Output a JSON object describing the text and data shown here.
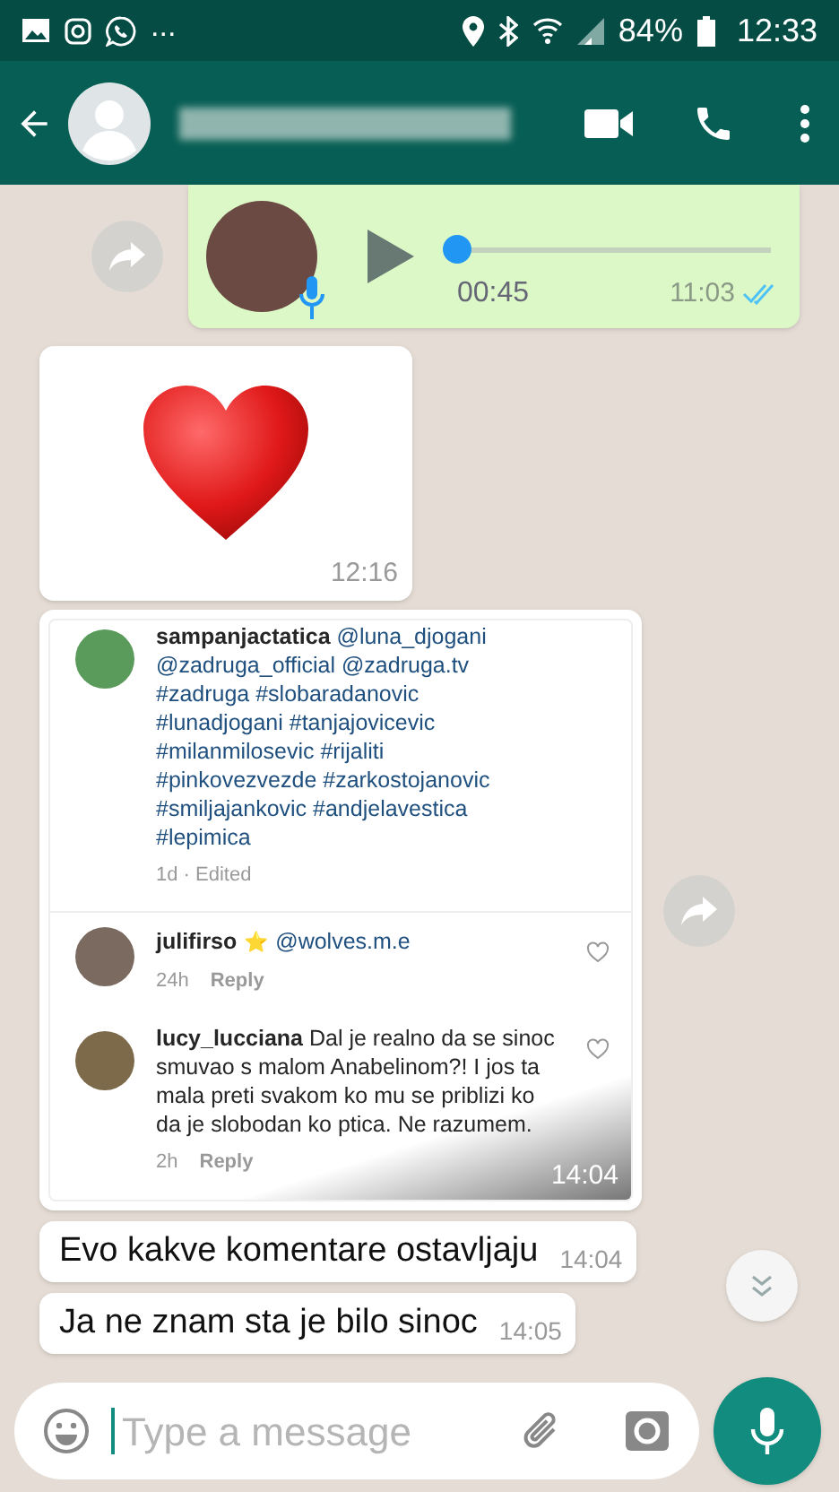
{
  "status_bar": {
    "more": "...",
    "battery": "84%",
    "time": "12:33"
  },
  "messages": [
    {
      "kind": "voice",
      "duration": "00:45",
      "time": "11:03",
      "level": 0,
      "read": true
    },
    {
      "kind": "sticker",
      "time": "12:16"
    },
    {
      "kind": "image",
      "time": "14:04",
      "comments": [
        {
          "user": "sampanjactatica",
          "text": "@luna_djogani @zadruga_official @zadruga.tv #zadruga #slobaradanovic #lunadjogani #tanjajovicevic #milanmilosevic #rijaliti #pinkovezvezde #zarkostojanovic #smiljajankovic #andjelavestica #lepimica",
          "meta": "1d · Edited"
        },
        {
          "user": "julifirso",
          "badge": "⭐",
          "text": "@wolves.m.e",
          "age": "24h",
          "reply": "Reply"
        },
        {
          "user": "lucy_lucciana",
          "text": "Dal je realno da se sinoc smuvao s malom Anabelinom?! I jos ta mala preti svakom ko mu se priblizi ko da je slobodan ko ptica. Ne razumem.",
          "age": "2h",
          "reply": "Reply"
        }
      ]
    },
    {
      "kind": "text",
      "text": "Evo kakve komentare ostavljaju",
      "time": "14:04"
    },
    {
      "kind": "text",
      "text": "Ja ne znam sta je bilo sinoc",
      "time": "14:05"
    }
  ],
  "composer": {
    "placeholder": "Type a message"
  }
}
